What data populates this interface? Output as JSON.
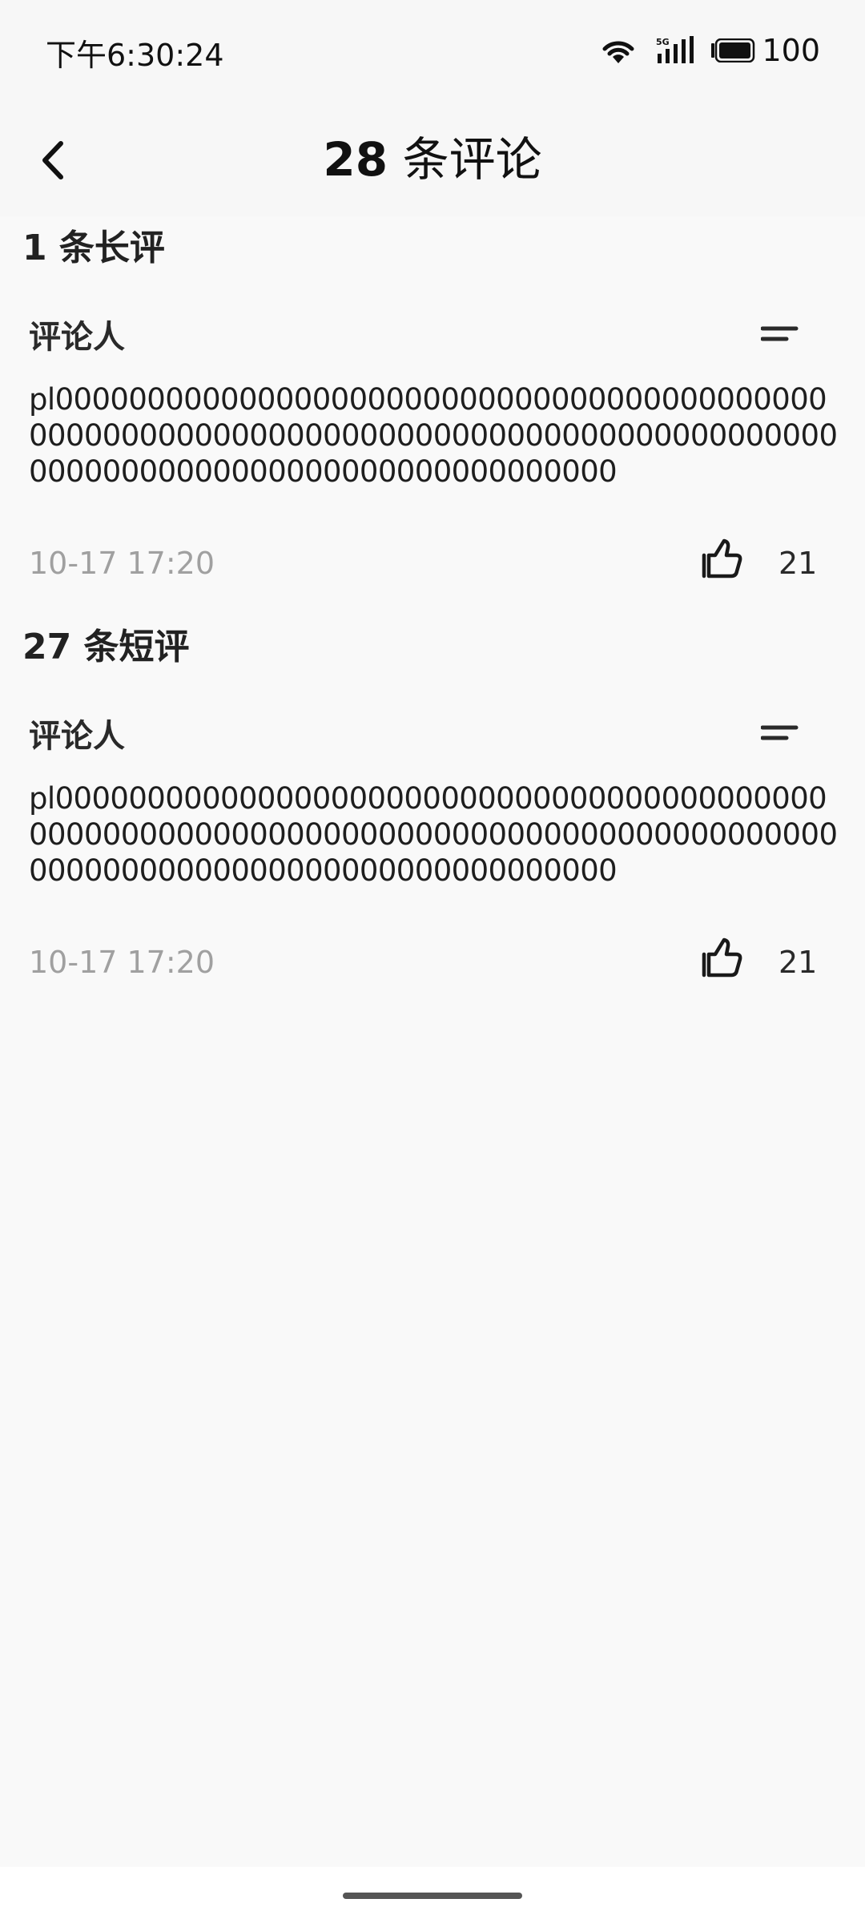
{
  "status_bar": {
    "time": "下午6:30:24",
    "battery": "100",
    "icons": [
      "wifi-icon",
      "signal-5g-icon",
      "battery-icon"
    ]
  },
  "app_bar": {
    "title_count": "28",
    "title_suffix": " 条评论",
    "back_icon": "chevron-left-icon"
  },
  "sections": [
    {
      "header": "1 条长评",
      "comments": [
        {
          "author": "评论人",
          "text": "pl0000000000000000000000000000000000000000000000000000000000000000000000000000000000000000000000000000000000000000000000",
          "time": "10-17 17:20",
          "likes": "21"
        }
      ]
    },
    {
      "header": "27 条短评",
      "comments": [
        {
          "author": "评论人",
          "text": "pl0000000000000000000000000000000000000000000000000000000000000000000000000000000000000000000000000000000000000000000000",
          "time": "10-17 17:20",
          "likes": "21"
        }
      ]
    }
  ],
  "colors": {
    "background": "#f9f9f9",
    "text_primary": "#1a1a1a",
    "text_secondary": "#a0a0a0"
  }
}
